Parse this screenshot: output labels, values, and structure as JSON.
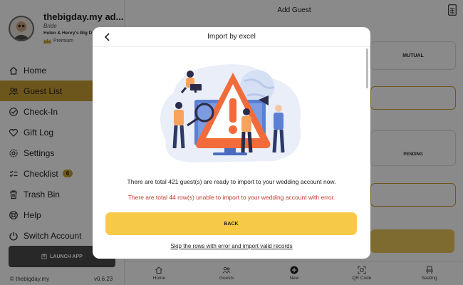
{
  "account": {
    "name": "thebigday.my ad...",
    "role": "Bride",
    "couple": "Helen & Henry's Big D...",
    "plan": "Premium"
  },
  "nav": {
    "items": [
      {
        "label": "Home",
        "icon": "home-icon"
      },
      {
        "label": "Guest List",
        "icon": "guests-icon",
        "active": true
      },
      {
        "label": "Check-In",
        "icon": "check-in-icon"
      },
      {
        "label": "Gift Log",
        "icon": "heart-icon"
      },
      {
        "label": "Settings",
        "icon": "gear-icon"
      },
      {
        "label": "Checklist",
        "icon": "checklist-icon",
        "badge": "6"
      },
      {
        "label": "Trash Bin",
        "icon": "trash-icon"
      },
      {
        "label": "Help",
        "icon": "help-icon"
      },
      {
        "label": "Switch Account",
        "icon": "switch-icon"
      }
    ],
    "launch_app": "LAUNCH APP"
  },
  "footer": {
    "copyright": "© thebigday.my",
    "version": "v0.6.23"
  },
  "main": {
    "title": "Add Guest",
    "mutual": "MUTUAL",
    "pending": "PENDING"
  },
  "bottom_tabs": [
    {
      "label": "Home",
      "icon": "home-icon"
    },
    {
      "label": "Guests",
      "icon": "guests-icon"
    },
    {
      "label": "New",
      "icon": "add-icon"
    },
    {
      "label": "QR Code",
      "icon": "qr-icon"
    },
    {
      "label": "Seating",
      "icon": "seat-icon"
    }
  ],
  "modal": {
    "title": "Import by excel",
    "ready_message": "There are total 421 guest(s) are ready to import to your wedding account now.",
    "error_message": "There are total 44 row(s) unable to import to your wedding account with error.",
    "back_button": "BACK",
    "skip_link": "Skip the rows with error and import valid records"
  },
  "colors": {
    "accent": "#c9a032",
    "button": "#f7c948",
    "error": "#c0392b",
    "warning": "#f26b3a"
  }
}
